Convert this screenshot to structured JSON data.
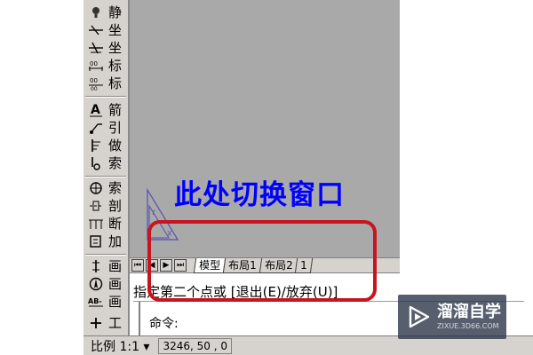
{
  "palette": {
    "items": [
      {
        "icon": "bulb-icon",
        "label": "静"
      },
      {
        "icon": "coordinate-icon",
        "label": "坐"
      },
      {
        "icon": "coordinate-icon",
        "label": "坐"
      },
      {
        "icon": "dimension-icon",
        "label": "标"
      },
      {
        "icon": "dimension-icon",
        "label": "标"
      },
      {
        "icon": "text-a-icon",
        "label": "箭"
      },
      {
        "icon": "leader-icon",
        "label": "引"
      },
      {
        "icon": "datum-icon",
        "label": "做"
      },
      {
        "icon": "index-icon",
        "label": "索"
      },
      {
        "icon": "crosshair-icon",
        "label": "索"
      },
      {
        "icon": "section-icon",
        "label": "剖"
      },
      {
        "icon": "break-icon",
        "label": "断"
      },
      {
        "icon": "add-icon",
        "label": "加"
      },
      {
        "icon": "drawing-icon",
        "label": "画"
      },
      {
        "icon": "north-icon",
        "label": "画"
      },
      {
        "icon": "title-icon",
        "label": "画"
      },
      {
        "icon": "plus-icon",
        "label": "工"
      }
    ]
  },
  "annotation": "此处切换窗口",
  "tabs": [
    "模型",
    "布局1",
    "布局2",
    "1"
  ],
  "nav_buttons": [
    "first",
    "prev",
    "next",
    "last"
  ],
  "command": {
    "line1": "指定第二个点或 [退出(E)/放弃(U)]",
    "line2": "命令:"
  },
  "status": {
    "scale": "比例 1:1 ▾",
    "coords": "3246, 50 , 0"
  },
  "watermark": {
    "title": "溜溜自学",
    "url": "ZIXUE.3D66.COM"
  },
  "colors": {
    "modelspace": "#a9a9a9",
    "annotation": "#0000ff",
    "highlight": "#c8141e",
    "chrome": "#d6d3ce"
  }
}
